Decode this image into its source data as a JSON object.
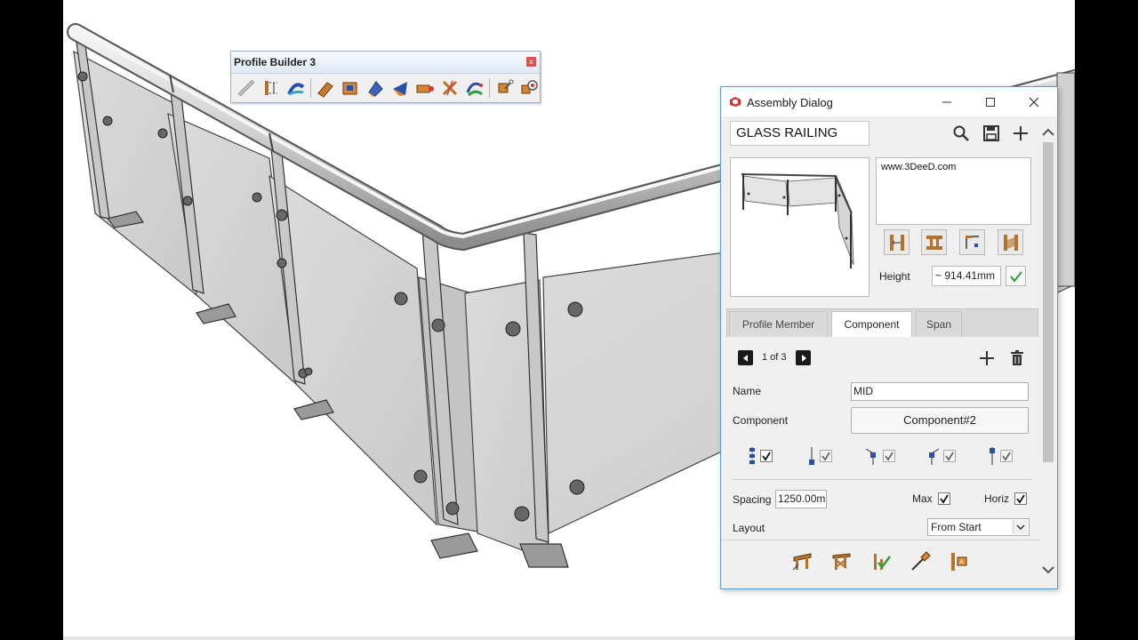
{
  "profile_builder": {
    "title": "Profile Builder 3",
    "close_label": "x",
    "tools": [
      "draw-member-icon",
      "member-ends-icon",
      "path-member-icon",
      "push-pull-icon",
      "box-icon",
      "rotate-icon",
      "flip-icon",
      "tape-icon",
      "cut-icon",
      "curve-icon",
      "zoom-select-icon",
      "zoom-extents-icon"
    ]
  },
  "dialog": {
    "title": "Assembly Dialog",
    "assembly_name": "GLASS RAILING",
    "notes": "www.3DeeD.com",
    "height_label": "Height",
    "height_value": "~ 914.41mm",
    "tabs": [
      "Profile Member",
      "Component",
      "Span"
    ],
    "active_tab": "Component",
    "pager": "1 of 3",
    "name_label": "Name",
    "name_value": "MID",
    "component_label": "Component",
    "component_value": "Component#2",
    "placements": [
      {
        "icon": "place-both-ends-icon",
        "checked": true
      },
      {
        "icon": "place-start-icon",
        "checked": true
      },
      {
        "icon": "place-corner-left-icon",
        "checked": true
      },
      {
        "icon": "place-corner-right-icon",
        "checked": true
      },
      {
        "icon": "place-end-icon",
        "checked": true
      }
    ],
    "spacing_label": "Spacing",
    "spacing_value": "1250.00mm",
    "max_label": "Max",
    "max_checked": true,
    "horiz_label": "Horiz",
    "horiz_checked": true,
    "layout_label": "Layout",
    "layout_value": "From Start",
    "colors": {
      "accent": "#5b9bd5",
      "check_green": "#2e9e3e",
      "wood": "#b5722c"
    }
  }
}
